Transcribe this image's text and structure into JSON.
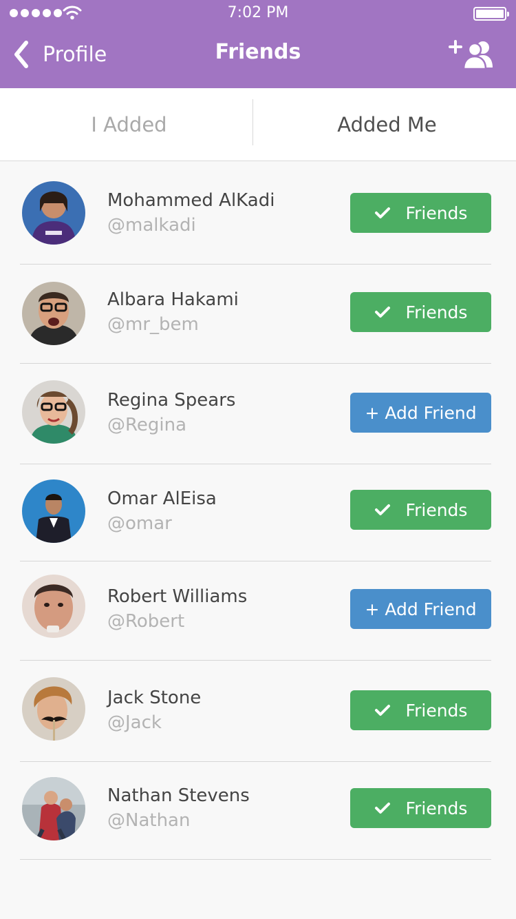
{
  "status_bar": {
    "time": "7:02 PM"
  },
  "nav": {
    "back_label": "Profile",
    "title": "Friends",
    "back_icon": "chevron-left-icon",
    "add_icon": "add-user-icon"
  },
  "tabs": [
    {
      "label": "I Added",
      "active": false
    },
    {
      "label": "Added Me",
      "active": true
    }
  ],
  "colors": {
    "header": "#a175c2",
    "friends_button": "#4cae63",
    "add_button": "#4a8fcb"
  },
  "friends": [
    {
      "name": "Mohammed AlKadi",
      "handle": "@malkadi",
      "status": "friends",
      "button_label": "Friends"
    },
    {
      "name": "Albara Hakami",
      "handle": "@mr_bem",
      "status": "friends",
      "button_label": "Friends"
    },
    {
      "name": "Regina Spears",
      "handle": "@Regina",
      "status": "add",
      "button_label": "+ Add Friend"
    },
    {
      "name": "Omar AlEisa",
      "handle": "@omar",
      "status": "friends",
      "button_label": "Friends"
    },
    {
      "name": "Robert Williams",
      "handle": "@Robert",
      "status": "add",
      "button_label": "+ Add Friend"
    },
    {
      "name": "Jack Stone",
      "handle": "@Jack",
      "status": "friends",
      "button_label": "Friends"
    },
    {
      "name": "Nathan Stevens",
      "handle": "@Nathan",
      "status": "friends",
      "button_label": "Friends"
    }
  ]
}
